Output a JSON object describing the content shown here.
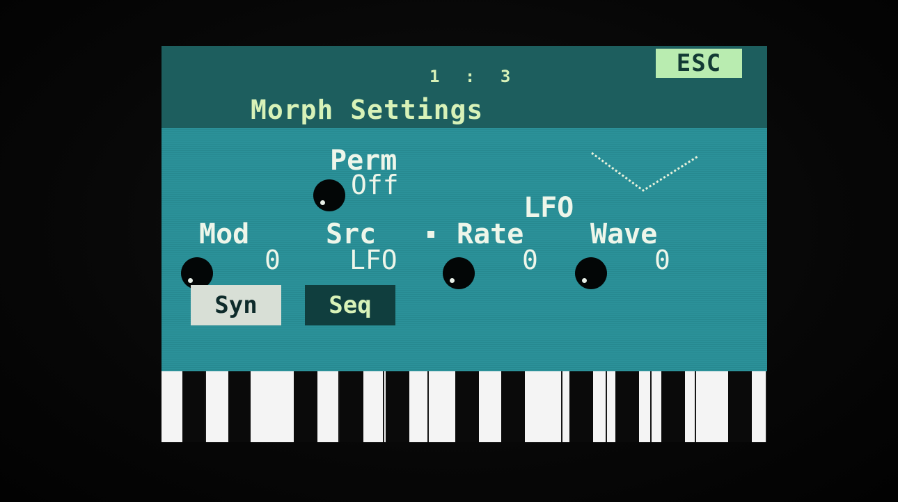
{
  "header": {
    "position_left": "1",
    "position_sep": ":",
    "position_right": "3",
    "esc_label": "ESC",
    "title": "Morph Settings"
  },
  "params": {
    "perm": {
      "label": "Perm",
      "value": "Off"
    },
    "mod": {
      "label": "Mod",
      "value": "0"
    },
    "src": {
      "label": "Src",
      "value": "LFO"
    },
    "lfo_heading": "LFO",
    "rate": {
      "label": "Rate",
      "value": "0"
    },
    "wave": {
      "label": "Wave",
      "value": "0"
    }
  },
  "softkeys": {
    "syn": "Syn",
    "seq": "Seq"
  },
  "colors": {
    "screen_bg": "#2a8f96",
    "header_bg": "#1d5e5e",
    "text": "#d8f2b8",
    "esc_bg": "#b9ecb0"
  }
}
